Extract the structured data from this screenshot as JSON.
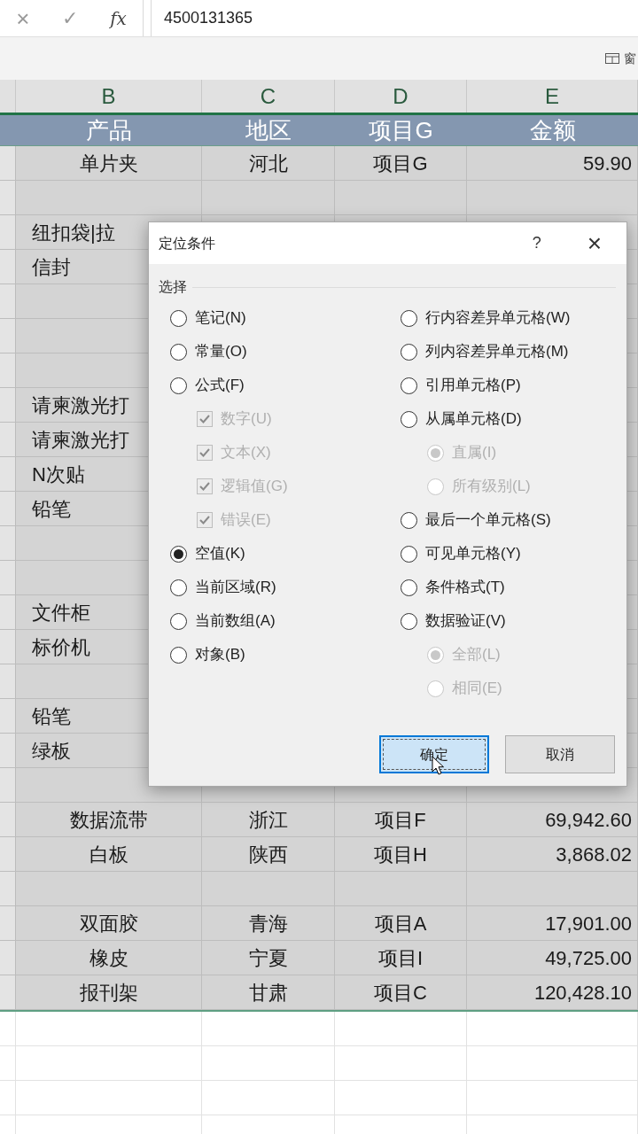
{
  "formula_bar": {
    "cancel": "×",
    "enter": "✓",
    "function": "fx",
    "value": "4500131365"
  },
  "ribbon": {
    "window_label": "窗"
  },
  "table": {
    "column_letters": [
      "B",
      "C",
      "D",
      "E"
    ],
    "header": [
      "产品",
      "地区",
      "项目G",
      "金额"
    ],
    "rows": [
      {
        "covered": false,
        "cells": [
          "单片夹",
          "河北",
          "项目G",
          "59.90"
        ]
      },
      {
        "cells": []
      },
      {
        "covered": true,
        "cells": [
          "纽扣袋|拉"
        ]
      },
      {
        "covered": true,
        "cells": [
          "信封"
        ]
      },
      {
        "cells": []
      },
      {
        "cells": []
      },
      {
        "cells": []
      },
      {
        "covered": true,
        "cells": [
          "请柬激光打"
        ]
      },
      {
        "covered": true,
        "cells": [
          "请柬激光打"
        ]
      },
      {
        "covered": true,
        "cells": [
          "N次贴"
        ]
      },
      {
        "covered": true,
        "cells": [
          "铅笔"
        ]
      },
      {
        "cells": []
      },
      {
        "cells": []
      },
      {
        "covered": true,
        "cells": [
          "文件柜"
        ]
      },
      {
        "covered": true,
        "cells": [
          "标价机"
        ]
      },
      {
        "cells": []
      },
      {
        "covered": true,
        "cells": [
          "铅笔"
        ]
      },
      {
        "covered": true,
        "cells": [
          "绿板"
        ]
      },
      {
        "cells": []
      },
      {
        "covered": false,
        "cells": [
          "数据流带",
          "浙江",
          "项目F",
          "69,942.60"
        ]
      },
      {
        "covered": false,
        "cells": [
          "白板",
          "陕西",
          "项目H",
          "3,868.02"
        ]
      },
      {
        "cells": []
      },
      {
        "covered": false,
        "cells": [
          "双面胶",
          "青海",
          "项目A",
          "17,901.00"
        ]
      },
      {
        "covered": false,
        "cells": [
          "橡皮",
          "宁夏",
          "项目I",
          "49,725.00"
        ]
      },
      {
        "covered": false,
        "cells": [
          "报刊架",
          "甘肃",
          "项目C",
          "120,428.10"
        ]
      }
    ]
  },
  "dialog": {
    "title": "定位条件",
    "help": "?",
    "close": "×",
    "group_label": "选择",
    "left_options": [
      {
        "kind": "radio",
        "label": "笔记(N)",
        "selected": false,
        "disabled": false
      },
      {
        "kind": "radio",
        "label": "常量(O)",
        "selected": false,
        "disabled": false
      },
      {
        "kind": "radio",
        "label": "公式(F)",
        "selected": false,
        "disabled": false,
        "children": [
          {
            "kind": "checkbox",
            "label": "数字(U)",
            "checked": true,
            "disabled": true
          },
          {
            "kind": "checkbox",
            "label": "文本(X)",
            "checked": true,
            "disabled": true
          },
          {
            "kind": "checkbox",
            "label": "逻辑值(G)",
            "checked": true,
            "disabled": true
          },
          {
            "kind": "checkbox",
            "label": "错误(E)",
            "checked": true,
            "disabled": true
          }
        ]
      },
      {
        "kind": "radio",
        "label": "空值(K)",
        "selected": true,
        "disabled": false
      },
      {
        "kind": "radio",
        "label": "当前区域(R)",
        "selected": false,
        "disabled": false
      },
      {
        "kind": "radio",
        "label": "当前数组(A)",
        "selected": false,
        "disabled": false
      },
      {
        "kind": "radio",
        "label": "对象(B)",
        "selected": false,
        "disabled": false
      }
    ],
    "right_options": [
      {
        "kind": "radio",
        "label": "行内容差异单元格(W)",
        "selected": false,
        "disabled": false
      },
      {
        "kind": "radio",
        "label": "列内容差异单元格(M)",
        "selected": false,
        "disabled": false
      },
      {
        "kind": "radio",
        "label": "引用单元格(P)",
        "selected": false,
        "disabled": false
      },
      {
        "kind": "radio",
        "label": "从属单元格(D)",
        "selected": false,
        "disabled": false,
        "children": [
          {
            "kind": "radio",
            "label": "直属(I)",
            "selected": true,
            "disabled": true
          },
          {
            "kind": "radio",
            "label": "所有级别(L)",
            "selected": false,
            "disabled": true
          }
        ]
      },
      {
        "kind": "radio",
        "label": "最后一个单元格(S)",
        "selected": false,
        "disabled": false
      },
      {
        "kind": "radio",
        "label": "可见单元格(Y)",
        "selected": false,
        "disabled": false
      },
      {
        "kind": "radio",
        "label": "条件格式(T)",
        "selected": false,
        "disabled": false
      },
      {
        "kind": "radio",
        "label": "数据验证(V)",
        "selected": false,
        "disabled": false,
        "children": [
          {
            "kind": "radio",
            "label": "全部(L)",
            "selected": true,
            "disabled": true
          },
          {
            "kind": "radio",
            "label": "相同(E)",
            "selected": false,
            "disabled": true
          }
        ]
      }
    ],
    "buttons": [
      {
        "label": "确定",
        "selected": true
      },
      {
        "label": "取消",
        "selected": false
      }
    ]
  }
}
